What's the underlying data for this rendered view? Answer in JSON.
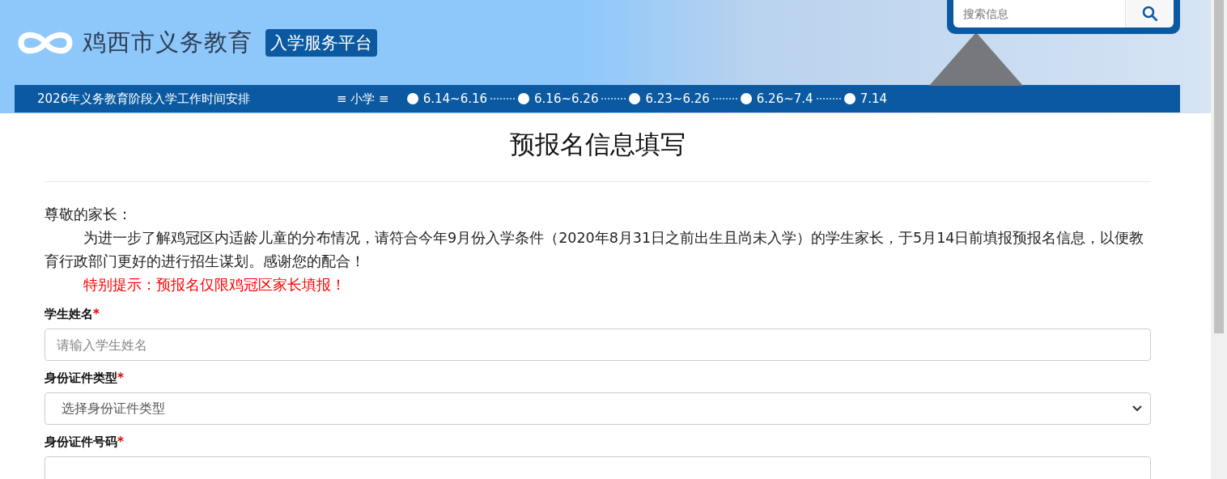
{
  "header": {
    "site_title": "鸡西市义务教育",
    "platform_badge": "入学服务平台",
    "search": {
      "placeholder": "搜索信息"
    }
  },
  "schedule_bar": {
    "title": "2026年义务教育阶段入学工作时间安排",
    "stage": "≡ 小学 ≡",
    "dates": [
      "6.14~6.16",
      "6.16~6.26",
      "6.23~6.26",
      "6.26~7.4",
      "7.14"
    ]
  },
  "form": {
    "title": "预报名信息填写",
    "greeting": "尊敬的家长：",
    "intro": "为进一步了解鸡冠区内适龄儿童的分布情况，请符合今年9月份入学条件（2020年8月31日之前出生且尚未入学）的学生家长，于5月14日前填报预报名信息，以便教育行政部门更好的进行招生谋划。感谢您的配合！",
    "notice": "特别提示：预报名仅限鸡冠区家长填报！",
    "fields": [
      {
        "label": "学生姓名",
        "mark": "*",
        "kind": "input",
        "placeholder": "请输入学生姓名"
      },
      {
        "label": "身份证件类型",
        "mark": "*",
        "kind": "select",
        "placeholder": "选择身份证件类型"
      },
      {
        "label": "身份证件号码",
        "mark": "*",
        "kind": "input"
      }
    ]
  }
}
